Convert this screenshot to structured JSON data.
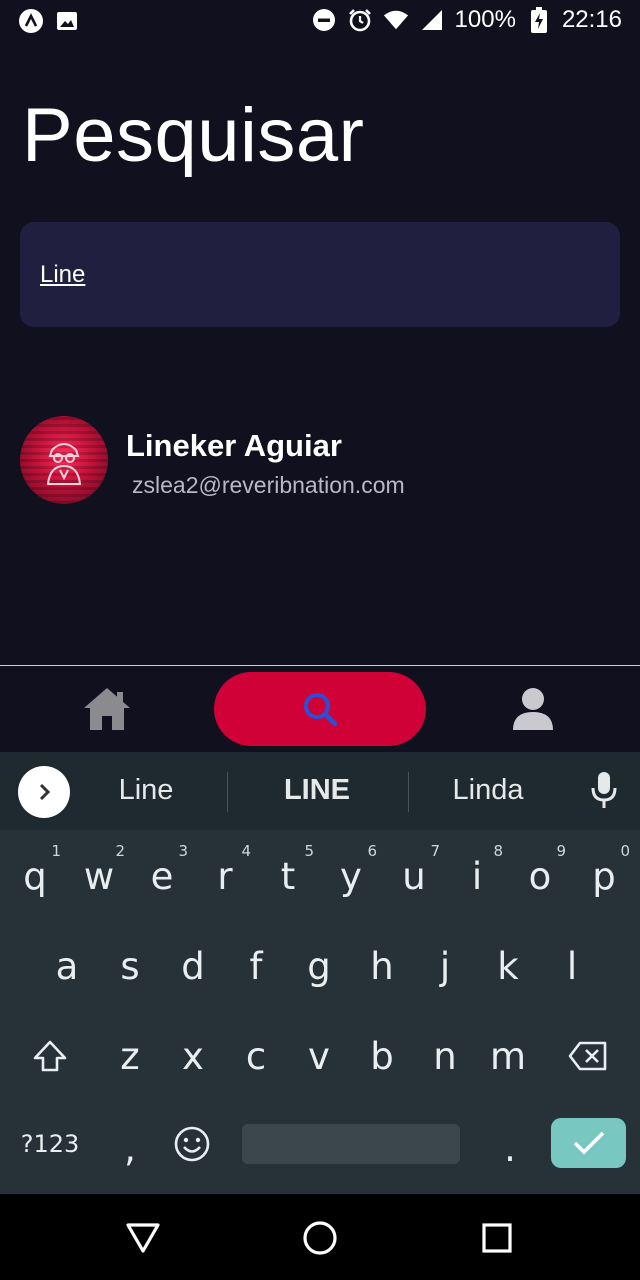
{
  "status_bar": {
    "battery": "100%",
    "time": "22:16"
  },
  "page": {
    "title": "Pesquisar"
  },
  "search": {
    "value": "Line"
  },
  "results": [
    {
      "name": "Lineker Aguiar",
      "email": "zslea2@reveribnation.com"
    }
  ],
  "bottom_nav": [
    "home-icon",
    "search-icon",
    "profile-icon"
  ],
  "keyboard": {
    "suggestions": [
      "Line",
      "LINE",
      "Linda"
    ],
    "row1": [
      {
        "k": "q",
        "h": "1"
      },
      {
        "k": "w",
        "h": "2"
      },
      {
        "k": "e",
        "h": "3"
      },
      {
        "k": "r",
        "h": "4"
      },
      {
        "k": "t",
        "h": "5"
      },
      {
        "k": "y",
        "h": "6"
      },
      {
        "k": "u",
        "h": "7"
      },
      {
        "k": "i",
        "h": "8"
      },
      {
        "k": "o",
        "h": "9"
      },
      {
        "k": "p",
        "h": "0"
      }
    ],
    "row2": [
      "a",
      "s",
      "d",
      "f",
      "g",
      "h",
      "j",
      "k",
      "l"
    ],
    "row3": [
      "z",
      "x",
      "c",
      "v",
      "b",
      "n",
      "m"
    ],
    "symbols_label": "?123",
    "comma": ",",
    "period": "."
  },
  "colors": {
    "accent": "#d00136",
    "background": "#11101f",
    "search_bg": "#211f3f",
    "enter": "#79c7c1"
  }
}
